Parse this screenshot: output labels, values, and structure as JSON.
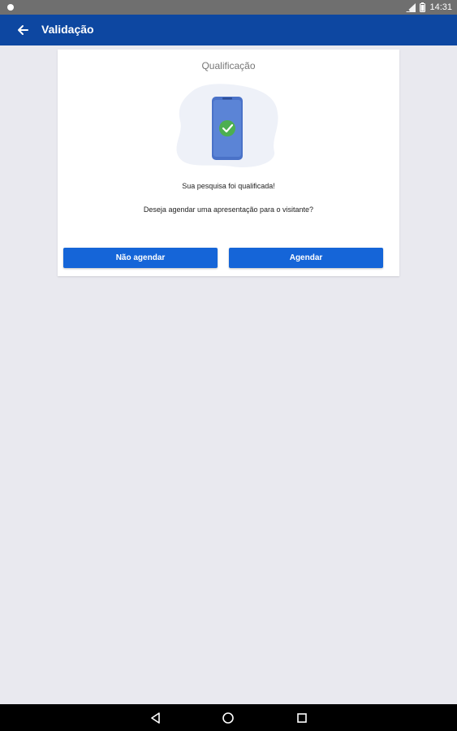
{
  "status_bar": {
    "time": "14:31"
  },
  "app_bar": {
    "title": "Validação",
    "back_icon": "arrow-left-icon"
  },
  "card": {
    "title": "Qualificação",
    "message": "Sua pesquisa foi  qualificada!",
    "question": "Deseja agendar uma apresentação para o visitante?",
    "illustration_icon": "phone-check-icon",
    "buttons": {
      "cancel_label": "Não agendar",
      "confirm_label": "Agendar"
    }
  },
  "nav_bar": {
    "icons": [
      "back-triangle-icon",
      "home-circle-icon",
      "recents-square-icon"
    ]
  },
  "colors": {
    "primary": "#0d47a1",
    "button": "#1565d8",
    "background": "#e9e9ef",
    "success": "#4caf50",
    "status_bar": "#6f6f6f"
  }
}
